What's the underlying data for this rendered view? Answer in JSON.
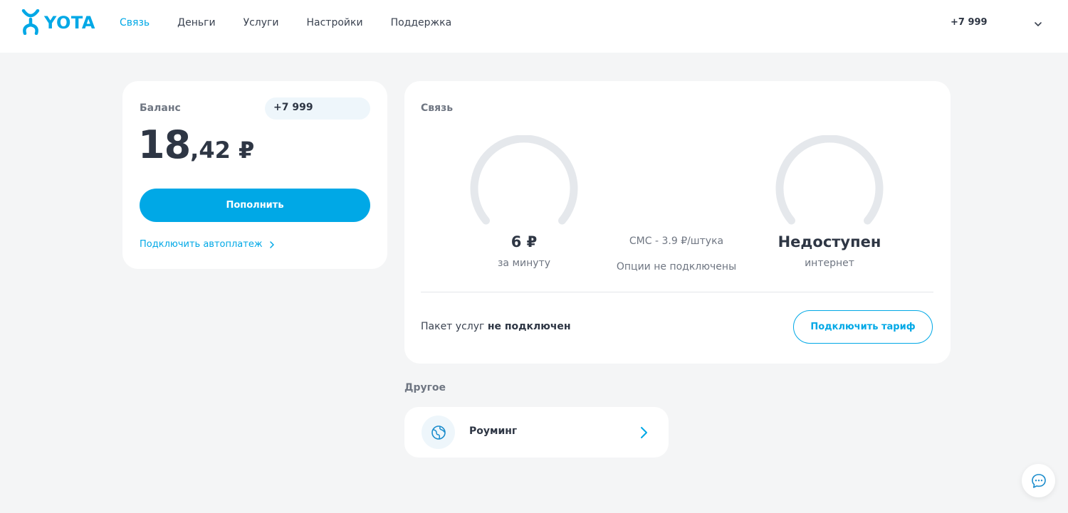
{
  "brand": {
    "name": "YOTA",
    "color": "#00a8e6"
  },
  "nav": {
    "items": [
      {
        "label": "Связь",
        "active": true
      },
      {
        "label": "Деньги",
        "active": false
      },
      {
        "label": "Услуги",
        "active": false
      },
      {
        "label": "Настройки",
        "active": false
      },
      {
        "label": "Поддержка",
        "active": false
      }
    ]
  },
  "account": {
    "phone": "+7 999",
    "icon": "chevron-down-icon"
  },
  "balance": {
    "label": "Баланс",
    "phone": "+7 999",
    "amount_int": "18",
    "amount_dec": ",42 ₽",
    "topup_label": "Пополнить",
    "autopay_label": "Подключить автоплатеж"
  },
  "communication": {
    "title": "Связь",
    "calls": {
      "value": "6 ₽",
      "caption": "за минуту",
      "gauge_fill": 0
    },
    "sms": {
      "line1": "СМС - 3.9 ₽/штука",
      "line2": "Опции не подключены"
    },
    "internet": {
      "value": "Недоступен",
      "caption": "интернет",
      "gauge_fill": 0
    },
    "package_prefix": "Пакет услуг",
    "package_status": "не подключен",
    "connect_label": "Подключить тариф"
  },
  "other": {
    "title": "Другое",
    "roaming": {
      "label": "Роуминг",
      "icon": "globe-icon"
    }
  },
  "chat": {
    "icon": "chat-icon"
  },
  "colors": {
    "accent": "#00a8e6",
    "gauge_track": "#e5e8ec",
    "background": "#f4f5f6"
  }
}
